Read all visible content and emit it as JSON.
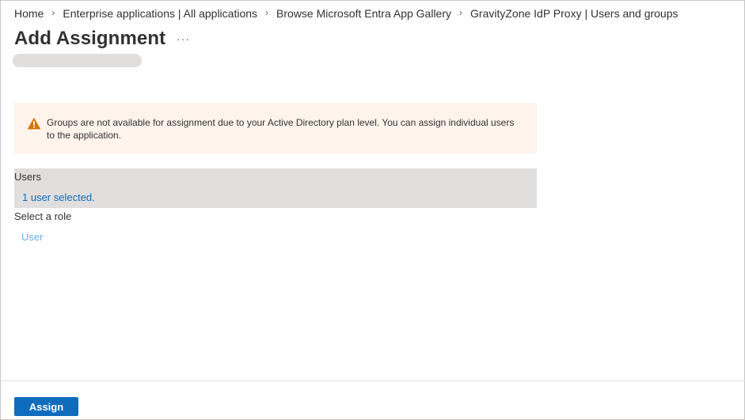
{
  "breadcrumb": {
    "items": [
      {
        "label": "Home"
      },
      {
        "label": "Enterprise applications | All applications"
      },
      {
        "label": "Browse Microsoft Entra App Gallery"
      },
      {
        "label": "GravityZone IdP Proxy | Users and groups"
      }
    ]
  },
  "header": {
    "title": "Add Assignment",
    "more_label": "···"
  },
  "warning": {
    "icon": "warning-icon",
    "color": "#d47500",
    "text": "Groups are not available for assignment due to your Active Directory plan level. You can assign individual users to the application."
  },
  "users": {
    "label": "Users",
    "selected_text": "1 user selected."
  },
  "role": {
    "label": "Select a role",
    "value": "User"
  },
  "footer": {
    "assign_label": "Assign"
  },
  "colors": {
    "accent": "#0f6cbd",
    "warning_bg": "#fff4ec",
    "section_bg": "#e1dfdd"
  }
}
